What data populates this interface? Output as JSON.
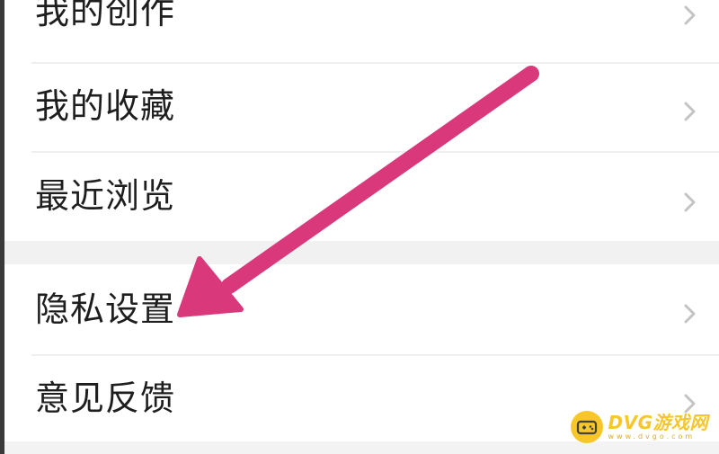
{
  "menu": {
    "items": [
      {
        "id": "my-creations",
        "label": "我的创作"
      },
      {
        "id": "my-favorites",
        "label": "我的收藏"
      },
      {
        "id": "recent-browsing",
        "label": "最近浏览"
      },
      {
        "id": "privacy-settings",
        "label": "隐私设置"
      },
      {
        "id": "feedback",
        "label": "意见反馈"
      }
    ],
    "chevron_icon": "chevron-right-icon"
  },
  "annotation": {
    "arrow_color": "#d9397a",
    "arrow_target": "privacy-settings"
  },
  "watermark": {
    "main": "DVG游戏网",
    "sub": "www.dvgo.com",
    "color": "#f6c21a"
  },
  "colors": {
    "text": "#1e1e1e",
    "divider": "#efefef",
    "section_gap": "#f1f1f1",
    "chevron": "#c4c4c4"
  }
}
